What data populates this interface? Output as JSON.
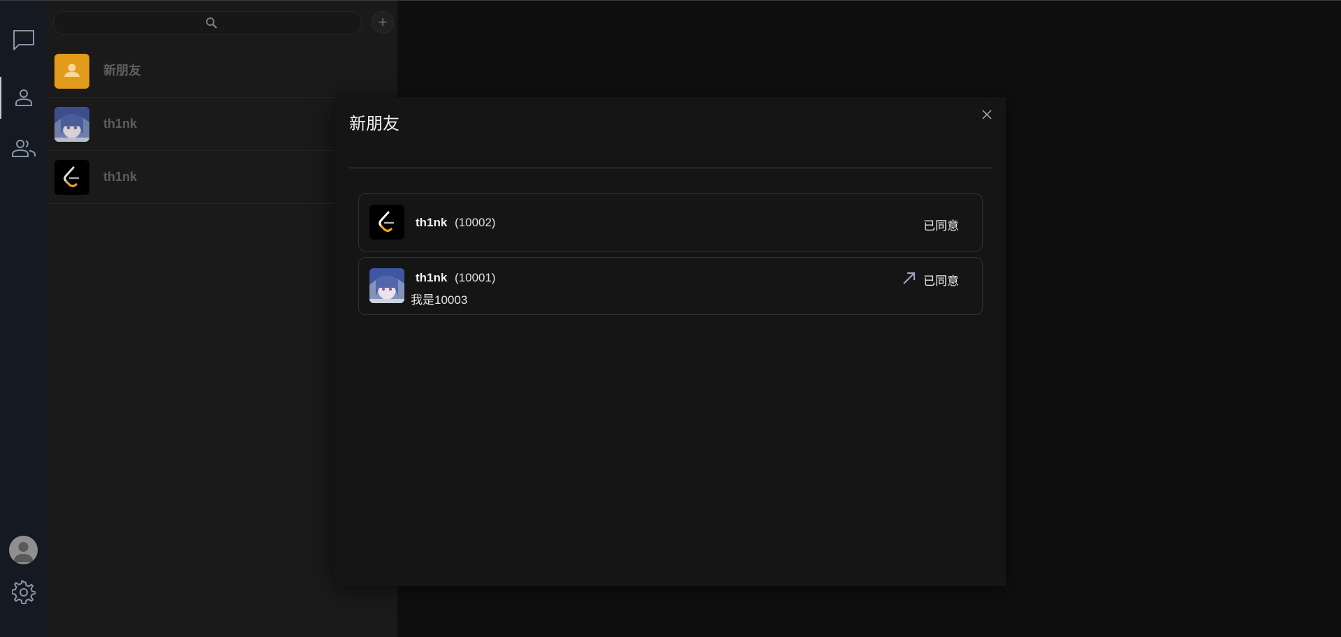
{
  "sidebar": {
    "items": [
      {
        "name": "chat",
        "icon": "chat-bubble-icon"
      },
      {
        "name": "contacts",
        "icon": "person-icon",
        "active": true
      },
      {
        "name": "groups",
        "icon": "group-icon"
      }
    ],
    "bottom": [
      {
        "name": "profile",
        "icon": "avatar-icon"
      },
      {
        "name": "settings",
        "icon": "gear-icon"
      }
    ]
  },
  "contacts": {
    "search_placeholder": "",
    "add_label": "+",
    "items": [
      {
        "label": "新朋友",
        "avatar": "new-friend-avatar"
      },
      {
        "label": "th1nk",
        "avatar": "anime-avatar"
      },
      {
        "label": "th1nk",
        "avatar": "leetcode-avatar"
      }
    ]
  },
  "modal": {
    "title": "新朋友",
    "requests": [
      {
        "name": "th1nk",
        "id": "(10002)",
        "message": "",
        "status": "已同意",
        "direction": "incoming",
        "avatar": "leetcode-avatar"
      },
      {
        "name": "th1nk",
        "id": "(10001)",
        "message": "我是10003",
        "status": "已同意",
        "direction": "outgoing",
        "avatar": "anime-avatar"
      }
    ]
  },
  "colors": {
    "accent": "#e39b1b",
    "rail_bg": "#141922",
    "pane_bg": "#1a1a1a",
    "modal_bg": "#151515"
  }
}
